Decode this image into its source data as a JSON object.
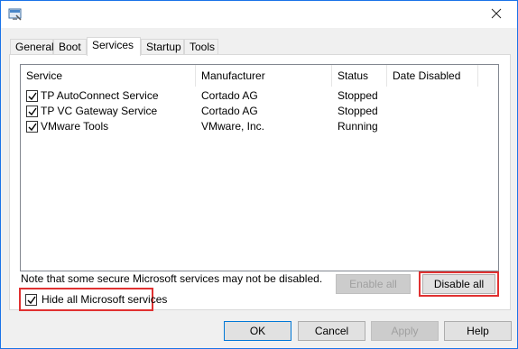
{
  "window": {
    "title_icon": "msconfig-icon",
    "close_icon": "close-icon"
  },
  "tabs": [
    {
      "label": "General",
      "active": false
    },
    {
      "label": "Boot",
      "active": false
    },
    {
      "label": "Services",
      "active": true
    },
    {
      "label": "Startup",
      "active": false
    },
    {
      "label": "Tools",
      "active": false
    }
  ],
  "services_table": {
    "columns": [
      "Service",
      "Manufacturer",
      "Status",
      "Date Disabled"
    ],
    "rows": [
      {
        "checked": true,
        "service": "TP AutoConnect Service",
        "manufacturer": "Cortado AG",
        "status": "Stopped",
        "date_disabled": ""
      },
      {
        "checked": true,
        "service": "TP VC Gateway Service",
        "manufacturer": "Cortado AG",
        "status": "Stopped",
        "date_disabled": ""
      },
      {
        "checked": true,
        "service": "VMware Tools",
        "manufacturer": "VMware, Inc.",
        "status": "Running",
        "date_disabled": ""
      }
    ]
  },
  "note": "Note that some secure Microsoft services may not be disabled.",
  "hide_ms": {
    "label": "Hide all Microsoft services",
    "checked": true
  },
  "buttons": {
    "enable_all": "Enable all",
    "disable_all": "Disable all",
    "ok": "OK",
    "cancel": "Cancel",
    "apply": "Apply",
    "help": "Help"
  },
  "colors": {
    "highlight": "#e03131",
    "window_border": "#1a73e8"
  }
}
